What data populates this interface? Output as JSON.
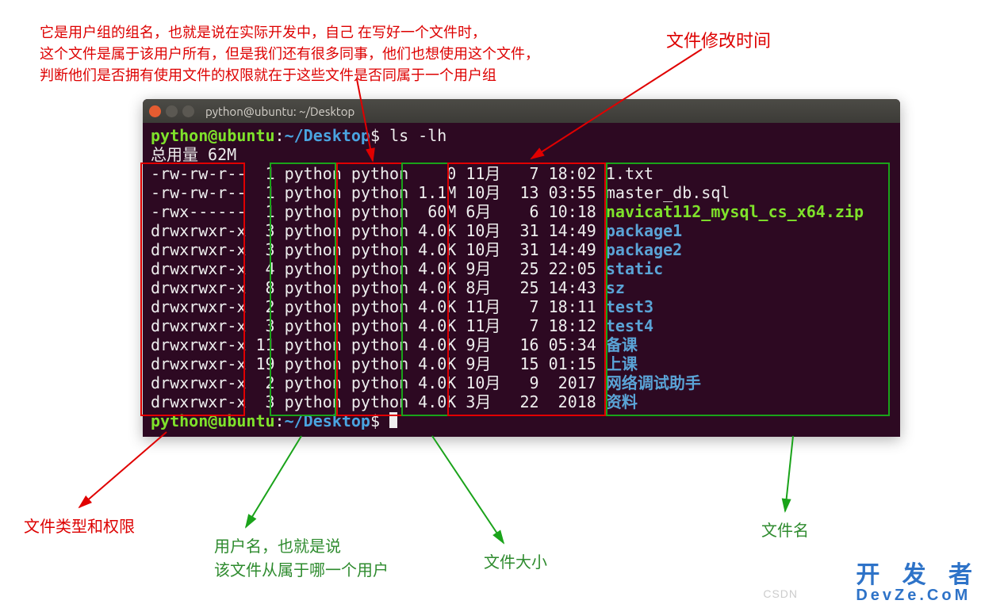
{
  "annotations": {
    "group_desc_l1": "它是用户组的组名，也就是说在实际开发中，自己 在写好一个文件时，",
    "group_desc_l2": "这个文件是属于该用户所有，但是我们还有很多同事，他们也想使用这个文件，",
    "group_desc_l3": "判断他们是否拥有使用文件的权限就在于这些文件是否同属于一个用户组",
    "modtime": "文件修改时间",
    "perms": "文件类型和权限",
    "user_l1": "用户名，也就是说",
    "user_l2": "该文件从属于哪一个用户",
    "size": "文件大小",
    "fname": "文件名"
  },
  "terminal": {
    "title": "python@ubuntu: ~/Desktop",
    "prompt_user": "python@ubuntu",
    "prompt_path": "~/Desktop",
    "prompt_sym": "$",
    "command": "ls -lh",
    "total": "总用量 62M",
    "rows": [
      {
        "perm": "-rw-rw-r--",
        "links": "1",
        "user": "python",
        "group": "python",
        "size": "0",
        "mon": "11月",
        "day": "7",
        "time": "18:02",
        "name": "1.txt",
        "cls": "fn-plain"
      },
      {
        "perm": "-rw-rw-r--",
        "links": "1",
        "user": "python",
        "group": "python",
        "size": "1.1M",
        "mon": "10月",
        "day": "13",
        "time": "03:55",
        "name": "master_db.sql",
        "cls": "fn-plain"
      },
      {
        "perm": "-rwx------",
        "links": "1",
        "user": "python",
        "group": "python",
        "size": "60M",
        "mon": "6月",
        "day": "6",
        "time": "10:18",
        "name": "navicat112_mysql_cs_x64.zip",
        "cls": "fn-exec"
      },
      {
        "perm": "drwxrwxr-x",
        "links": "3",
        "user": "python",
        "group": "python",
        "size": "4.0K",
        "mon": "10月",
        "day": "31",
        "time": "14:49",
        "name": "package1",
        "cls": "fn-dir"
      },
      {
        "perm": "drwxrwxr-x",
        "links": "3",
        "user": "python",
        "group": "python",
        "size": "4.0K",
        "mon": "10月",
        "day": "31",
        "time": "14:49",
        "name": "package2",
        "cls": "fn-dir"
      },
      {
        "perm": "drwxrwxr-x",
        "links": "4",
        "user": "python",
        "group": "python",
        "size": "4.0K",
        "mon": "9月",
        "day": "25",
        "time": "22:05",
        "name": "static",
        "cls": "fn-dir"
      },
      {
        "perm": "drwxrwxr-x",
        "links": "8",
        "user": "python",
        "group": "python",
        "size": "4.0K",
        "mon": "8月",
        "day": "25",
        "time": "14:43",
        "name": "sz",
        "cls": "fn-dir"
      },
      {
        "perm": "drwxrwxr-x",
        "links": "2",
        "user": "python",
        "group": "python",
        "size": "4.0K",
        "mon": "11月",
        "day": "7",
        "time": "18:11",
        "name": "test3",
        "cls": "fn-dir"
      },
      {
        "perm": "drwxrwxr-x",
        "links": "3",
        "user": "python",
        "group": "python",
        "size": "4.0K",
        "mon": "11月",
        "day": "7",
        "time": "18:12",
        "name": "test4",
        "cls": "fn-dir"
      },
      {
        "perm": "drwxrwxr-x",
        "links": "11",
        "user": "python",
        "group": "python",
        "size": "4.0K",
        "mon": "9月",
        "day": "16",
        "time": "05:34",
        "name": "备课",
        "cls": "fn-dir"
      },
      {
        "perm": "drwxrwxr-x",
        "links": "19",
        "user": "python",
        "group": "python",
        "size": "4.0K",
        "mon": "9月",
        "day": "15",
        "time": "01:15",
        "name": "上课",
        "cls": "fn-dir"
      },
      {
        "perm": "drwxrwxr-x",
        "links": "2",
        "user": "python",
        "group": "python",
        "size": "4.0K",
        "mon": "10月",
        "day": "9",
        "time": "2017",
        "name": "网络调试助手",
        "cls": "fn-dir"
      },
      {
        "perm": "drwxrwxr-x",
        "links": "3",
        "user": "python",
        "group": "python",
        "size": "4.0K",
        "mon": "3月",
        "day": "22",
        "time": "2018",
        "name": "资料",
        "cls": "fn-dir"
      }
    ]
  },
  "watermark": {
    "csdn": "CSDN",
    "brand_cn": "开 发 者",
    "brand_en": "DevZe.CoM"
  }
}
